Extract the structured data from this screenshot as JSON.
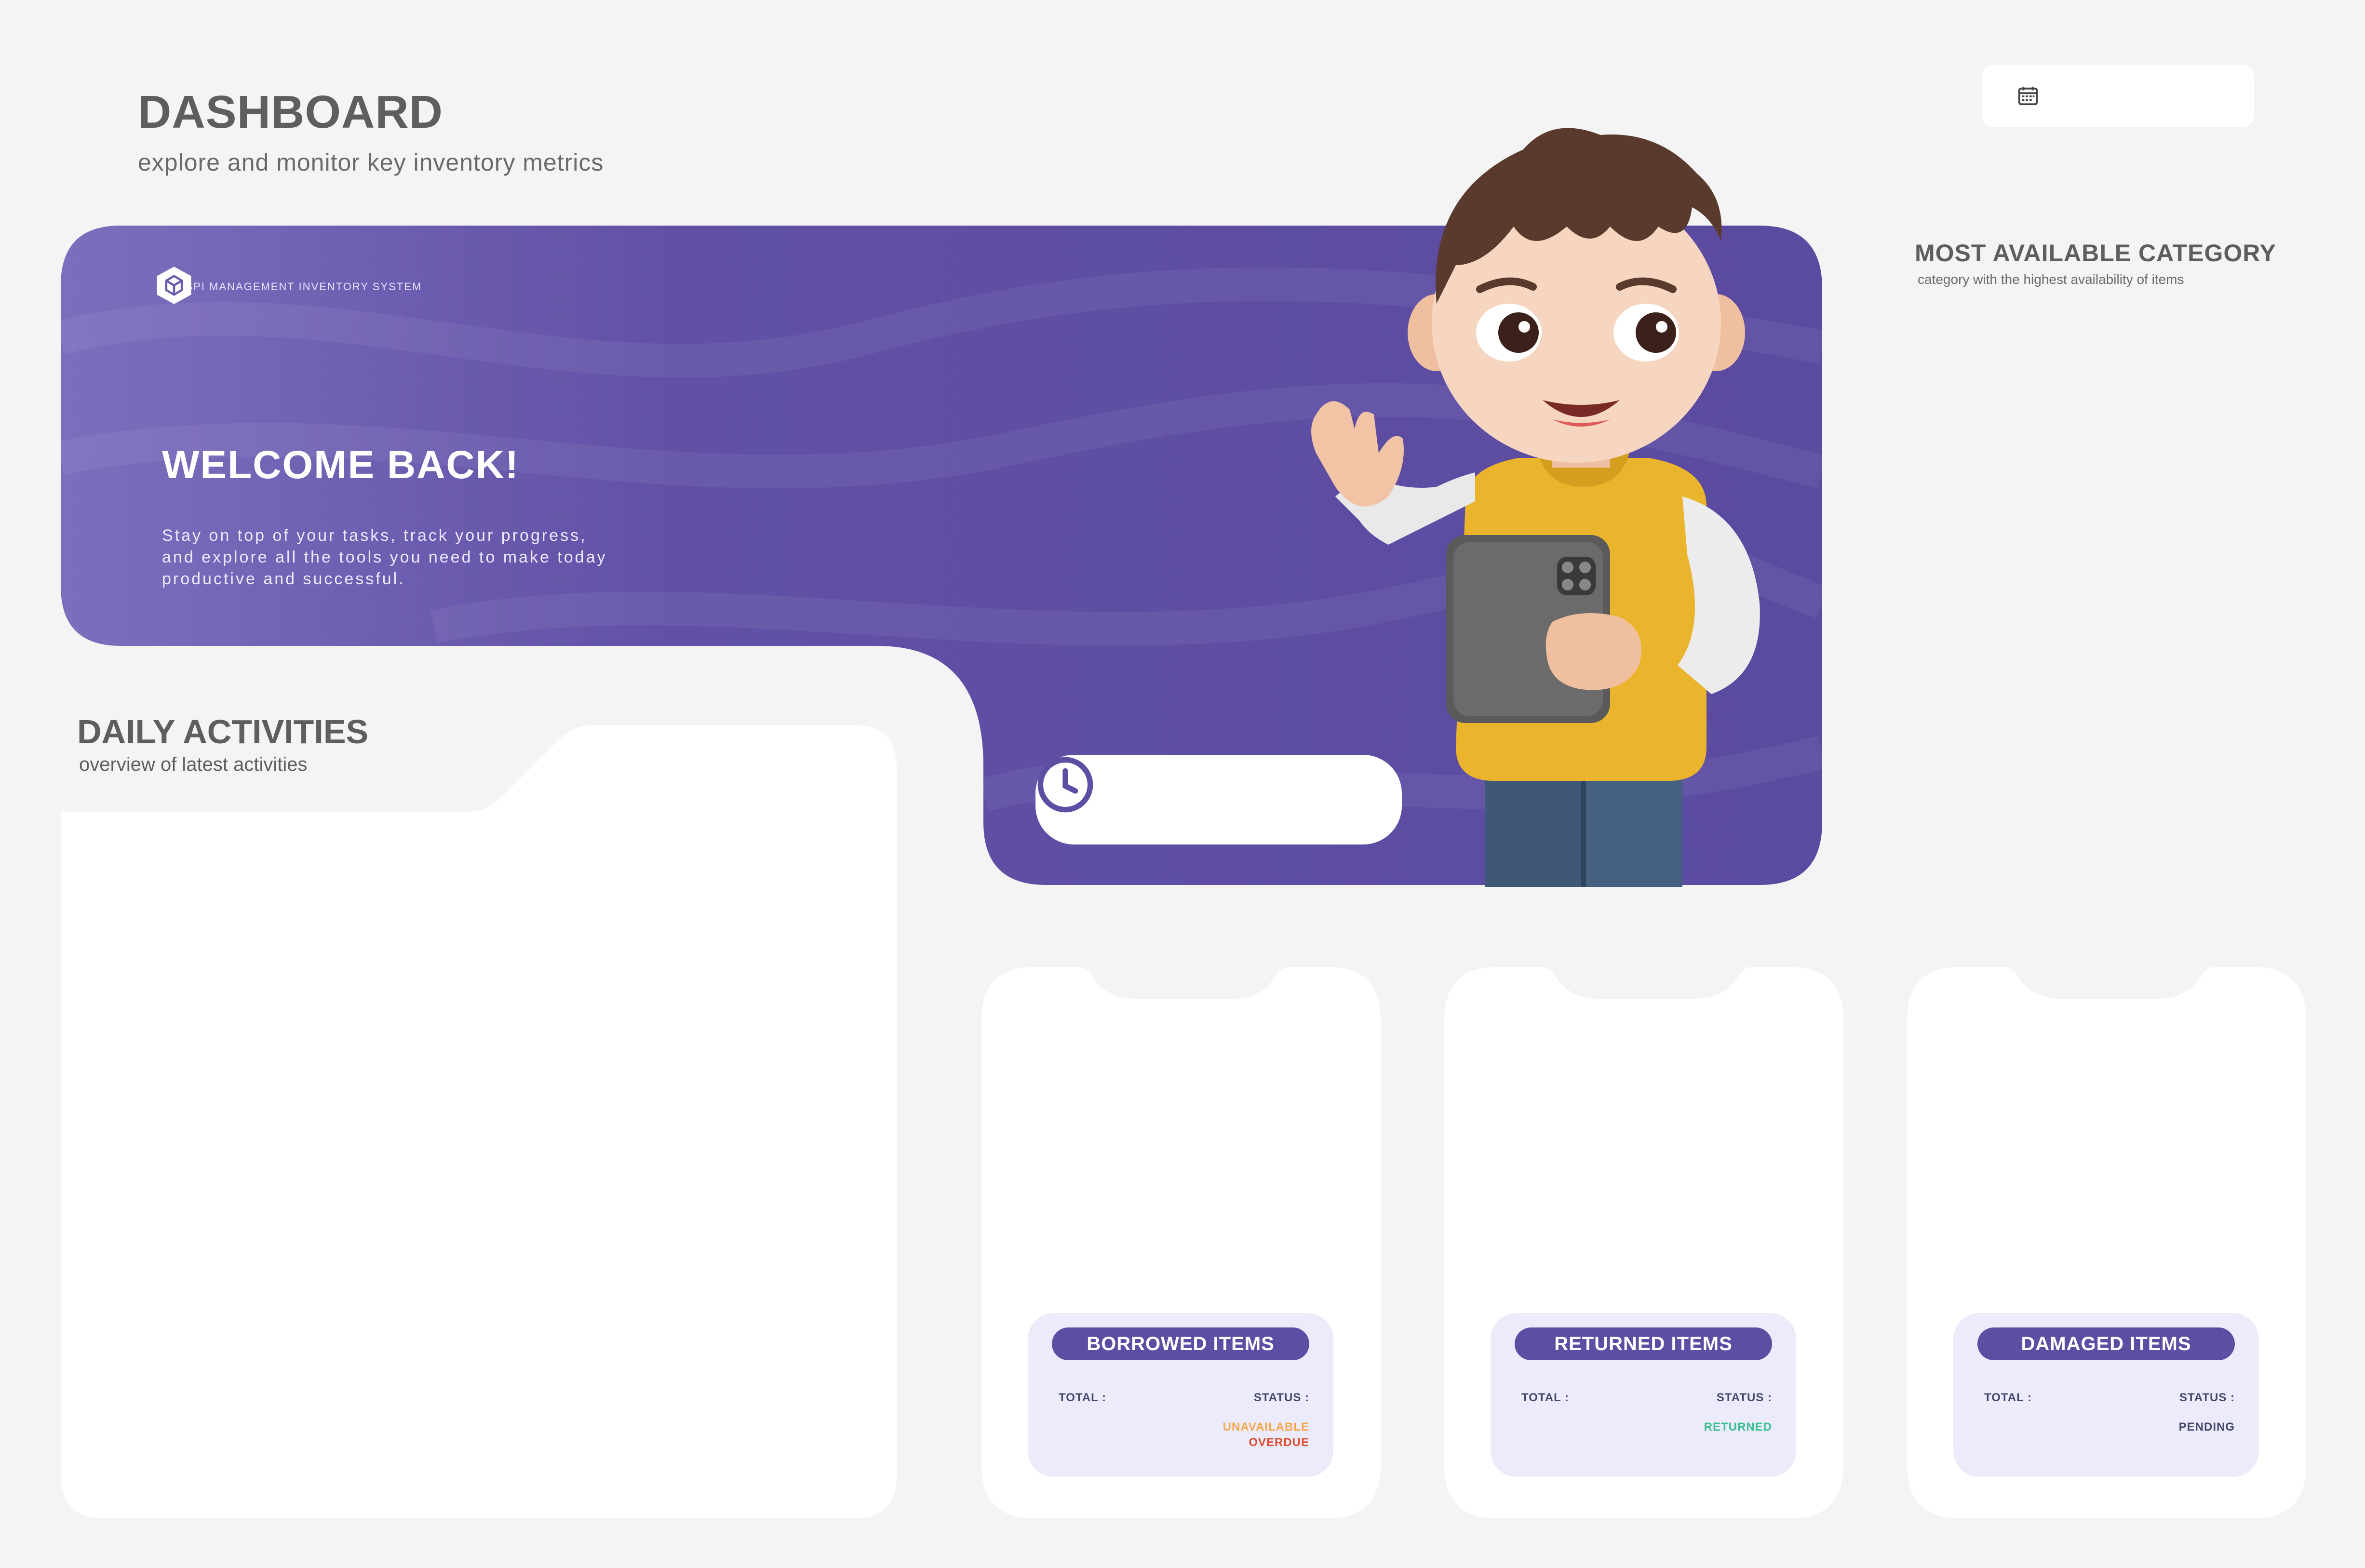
{
  "header": {
    "title": "DASHBOARD",
    "subtitle": "explore and monitor key inventory metrics",
    "date_picker_icon": "calendar-icon"
  },
  "banner": {
    "brand_name": "NBSPI MANAGEMENT INVENTORY SYSTEM",
    "brand_icon": "cube-logo-icon",
    "welcome_title": "WELCOME BACK!",
    "welcome_lines": [
      "Stay on top of your tasks, track your progress,",
      "and explore all the tools you need to make today",
      "productive and successful."
    ],
    "clock_icon": "clock-icon",
    "accent_color": "#5c4ea3"
  },
  "category": {
    "title": "MOST AVAILABLE CATEGORY",
    "subtitle": "category with the highest availability of items"
  },
  "daily": {
    "title": "DAILY ACTIVITIES",
    "subtitle": "overview of latest activities"
  },
  "stats": [
    {
      "title": "BORROWED ITEMS",
      "total_label": "TOTAL :",
      "status_label": "STATUS :",
      "status_values": [
        {
          "text": "UNAVAILABLE",
          "color": "#f5a54a"
        },
        {
          "text": "OVERDUE",
          "color": "#e04a2f"
        }
      ]
    },
    {
      "title": "RETURNED ITEMS",
      "total_label": "TOTAL :",
      "status_label": "STATUS :",
      "status_values": [
        {
          "text": "RETURNED",
          "color": "#3bbf8e"
        }
      ]
    },
    {
      "title": "DAMAGED ITEMS",
      "total_label": "TOTAL :",
      "status_label": "STATUS :",
      "status_values": [
        {
          "text": "PENDING",
          "color": "#46466b"
        }
      ]
    }
  ]
}
